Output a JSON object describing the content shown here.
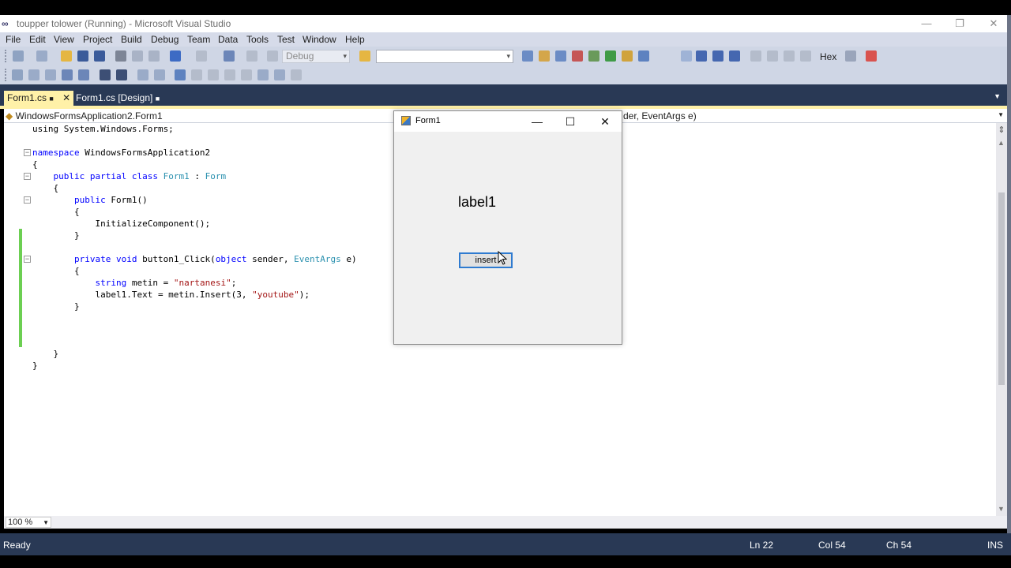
{
  "window": {
    "title": "toupper tolower (Running) - Microsoft Visual Studio",
    "minimize": "—",
    "restore": "❐",
    "close": "✕"
  },
  "menu": [
    "File",
    "Edit",
    "View",
    "Project",
    "Build",
    "Debug",
    "Team",
    "Data",
    "Tools",
    "Test",
    "Window",
    "Help"
  ],
  "toolbar": {
    "config_select": "Debug",
    "search_select": "",
    "hex_label": "Hex"
  },
  "tabs": [
    {
      "label": "Form1.cs",
      "active": true,
      "lock": "🔒",
      "close": "✕"
    },
    {
      "label": "Form1.cs [Design]",
      "active": false,
      "lock": "🔒"
    }
  ],
  "navbar": {
    "left": "WindowsFormsApplication2.Form1",
    "right": "der, EventArgs e)"
  },
  "code": [
    {
      "parts": [
        [
          "",
          "using System.Windows.Forms;"
        ]
      ]
    },
    {
      "parts": [
        [
          "",
          ""
        ]
      ]
    },
    {
      "parts": [
        [
          "kw",
          "namespace"
        ],
        [
          "",
          " WindowsFormsApplication2"
        ]
      ]
    },
    {
      "parts": [
        [
          "",
          "{"
        ]
      ]
    },
    {
      "parts": [
        [
          "",
          "    "
        ],
        [
          "kw",
          "public partial class"
        ],
        [
          "",
          " "
        ],
        [
          "ty",
          "Form1"
        ],
        [
          "",
          " : "
        ],
        [
          "ty",
          "Form"
        ]
      ]
    },
    {
      "parts": [
        [
          "",
          "    {"
        ]
      ]
    },
    {
      "parts": [
        [
          "",
          "        "
        ],
        [
          "kw",
          "public"
        ],
        [
          "",
          " Form1()"
        ]
      ]
    },
    {
      "parts": [
        [
          "",
          "        {"
        ]
      ]
    },
    {
      "parts": [
        [
          "",
          "            InitializeComponent();"
        ]
      ]
    },
    {
      "parts": [
        [
          "",
          "        }"
        ]
      ]
    },
    {
      "parts": [
        [
          "",
          ""
        ]
      ]
    },
    {
      "parts": [
        [
          "",
          "        "
        ],
        [
          "kw",
          "private void"
        ],
        [
          "",
          " button1_Click("
        ],
        [
          "kw",
          "object"
        ],
        [
          "",
          " sender, "
        ],
        [
          "ty",
          "EventArgs"
        ],
        [
          "",
          " e)"
        ]
      ]
    },
    {
      "parts": [
        [
          "",
          "        {"
        ]
      ]
    },
    {
      "parts": [
        [
          "",
          "            "
        ],
        [
          "kw",
          "string"
        ],
        [
          "",
          " metin = "
        ],
        [
          "str",
          "\"nartanesi\""
        ],
        [
          "",
          ";"
        ]
      ]
    },
    {
      "parts": [
        [
          "",
          "            label1.Text = metin.Insert(3, "
        ],
        [
          "str",
          "\"youtube\""
        ],
        [
          "",
          ");"
        ]
      ]
    },
    {
      "parts": [
        [
          "",
          "        }"
        ]
      ]
    },
    {
      "parts": [
        [
          "",
          ""
        ]
      ]
    },
    {
      "parts": [
        [
          "",
          ""
        ]
      ]
    },
    {
      "parts": [
        [
          "",
          ""
        ]
      ]
    },
    {
      "parts": [
        [
          "",
          "    }"
        ]
      ]
    },
    {
      "parts": [
        [
          "",
          "}"
        ]
      ]
    }
  ],
  "editor": {
    "zoom": "100 %"
  },
  "status": {
    "ready": "Ready",
    "line": "Ln 22",
    "col": "Col 54",
    "ch": "Ch 54",
    "mode": "INS"
  },
  "form": {
    "title": "Form1",
    "label": "label1",
    "button": "insert"
  },
  "colors": {
    "accent_tab": "#fff1a8",
    "chrome_dark": "#293955",
    "change_bar": "#6ccf52"
  }
}
